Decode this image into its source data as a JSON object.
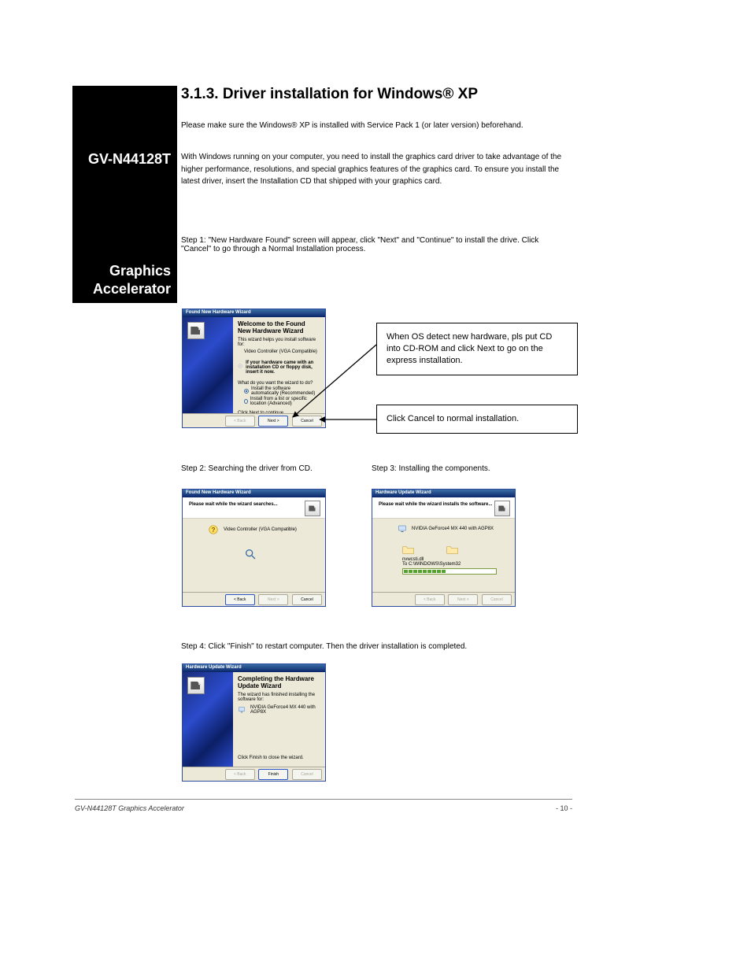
{
  "sidebar": {
    "caption1": "GV-N44128T",
    "caption2": "Graphics Accelerator"
  },
  "section": {
    "heading": "3.1.3. Driver installation for Windows® XP"
  },
  "intro": [
    "Please make sure the Windows® XP is installed with Service Pack 1 (or later version) beforehand.",
    "With Windows running on your computer, you need to install the graphics card driver to take advantage of the higher performance, resolutions, and special graphics features of the graphics card. To ensure you install the latest driver, insert the Installation CD that shipped with your graphics card."
  ],
  "step1": {
    "label": "Step 1:",
    "text": "\"New Hardware Found\" screen will appear, click \"Next\" and \"Continue\" to install the drive. Click \"Cancel\" to go through a Normal Installation process."
  },
  "callouts": {
    "c1": [
      "When OS detect new hardware, pls put CD",
      "into CD-ROM and click Next to go on the",
      "express installation."
    ],
    "c2": [
      "Click Cancel to normal installation."
    ]
  },
  "dialog1": {
    "title": "Found New Hardware Wizard",
    "heading": "Welcome to the Found New Hardware Wizard",
    "line1": "This wizard helps you install software for:",
    "device": "Video Controller (VGA Compatible)",
    "tip": "If your hardware came with an installation CD or floppy disk, insert it now.",
    "prompt": "What do you want the wizard to do?",
    "opt1": "Install the software automatically (Recommended)",
    "opt2": "Install from a list or specific location (Advanced)",
    "cont": "Click Next to continue.",
    "back": "< Back",
    "next": "Next >",
    "cancel": "Cancel"
  },
  "step2": {
    "label": "Step 2:",
    "text": "Searching the driver from CD."
  },
  "dialog2": {
    "title": "Found New Hardware Wizard",
    "heading": "Please wait while the wizard searches...",
    "device": "Video Controller (VGA Compatible)",
    "back": "< Back",
    "next": "Next >",
    "cancel": "Cancel"
  },
  "step3": {
    "label": "Step 3:",
    "text": "Installing the components."
  },
  "dialog3": {
    "title": "Hardware Update Wizard",
    "heading": "Please wait while the wizard installs the software...",
    "device": "NVIDIA GeForce4 MX 440 with AGP8X",
    "file": "nvwcsti.dll",
    "dest": "To C:\\WINDOWS\\System32",
    "back": "< Back",
    "next": "Next >",
    "cancel": "Cancel"
  },
  "step4": {
    "label": "Step 4:",
    "text": "Click \"Finish\" to restart computer. Then the driver installation is completed."
  },
  "dialog4": {
    "title": "Hardware Update Wizard",
    "heading": "Completing the Hardware Update Wizard",
    "line1": "The wizard has finished installing the software for:",
    "device": "NVIDIA GeForce4 MX 440 with AGP8X",
    "cont": "Click Finish to close the wizard.",
    "back": "< Back",
    "finish": "Finish",
    "cancel": "Cancel"
  },
  "footer": {
    "left": "GV-N44128T Graphics Accelerator",
    "right": "- 10 -"
  }
}
